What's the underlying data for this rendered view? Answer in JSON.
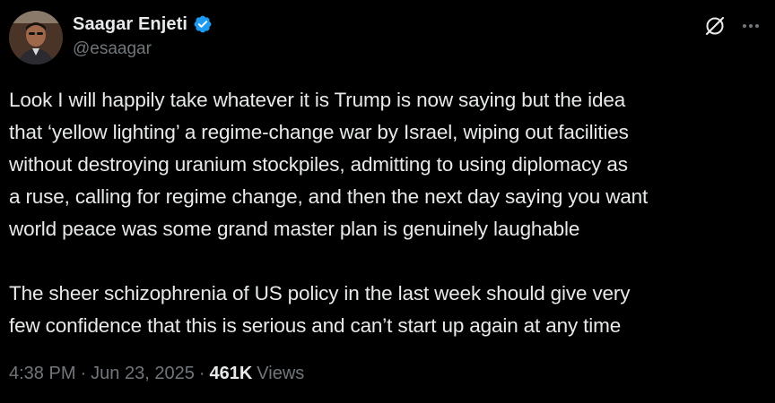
{
  "author": {
    "display_name": "Saagar Enjeti",
    "handle": "@esaagar",
    "verified": true,
    "verified_color": "#1d9bf0"
  },
  "icons": {
    "grok": "grok-icon",
    "more": "more-horizontal-icon",
    "verified": "verified-badge-icon"
  },
  "tweet": {
    "paragraphs": [
      "Look I will happily take whatever it is Trump is now saying but the idea\nthat ‘yellow lighting’ a regime-change war by Israel, wiping out facilities\nwithout destroying uranium stockpiles, admitting to using diplomacy as\na ruse, calling for regime change, and then the next day saying you want\nworld peace was some grand master plan is genuinely laughable",
      "The sheer schizophrenia of US policy in the last week should give very\nfew confidence that this is serious and can’t start up again at any time"
    ]
  },
  "meta": {
    "time": "4:38 PM",
    "date": "Jun 23, 2025",
    "views_count": "461K",
    "views_label": "Views",
    "separator": "·"
  },
  "colors": {
    "background": "#000000",
    "text_primary": "#e7e9ea",
    "text_secondary": "#71767b"
  }
}
